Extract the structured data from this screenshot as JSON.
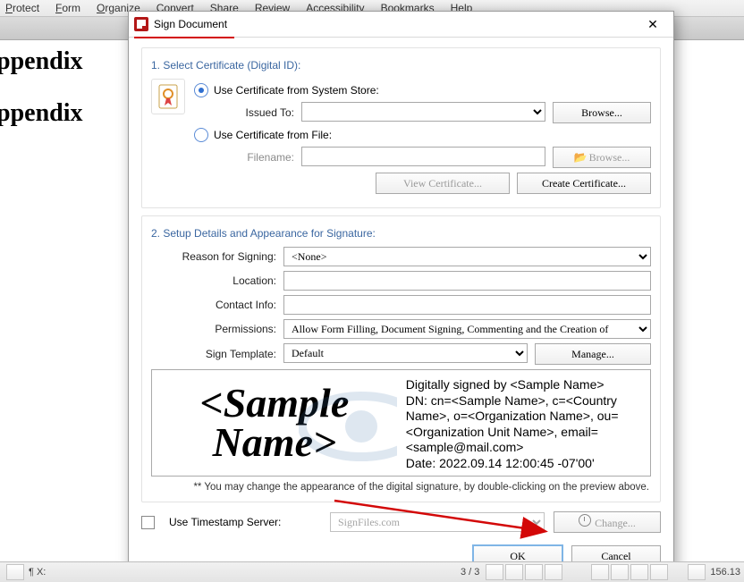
{
  "menu": {
    "items": [
      "Protect",
      "Form",
      "Organize",
      "Convert",
      "Share",
      "Review",
      "Accessibility",
      "Bookmarks",
      "Help"
    ],
    "ul": [
      "P",
      "F",
      "O",
      "C",
      "S",
      "R",
      "A",
      "B",
      "H"
    ]
  },
  "bg": {
    "line1": "ppendix",
    "line2": "ppendix"
  },
  "dialog": {
    "title": "Sign Document",
    "section1": "1. Select Certificate (Digital ID):",
    "opt_store": "Use Certificate from System Store:",
    "issued_to": "Issued To:",
    "browse": "Browse...",
    "opt_file": "Use Certificate from File:",
    "filename": "Filename:",
    "browse2": "Browse...",
    "view_cert": "View Certificate...",
    "create_cert": "Create Certificate...",
    "section2": "2. Setup Details and Appearance for Signature:",
    "reason_lbl": "Reason for Signing:",
    "reason_val": "<None>",
    "location_lbl": "Location:",
    "contact_lbl": "Contact Info:",
    "perm_lbl": "Permissions:",
    "perm_val": "Allow Form Filling, Document Signing, Commenting and the Creation of",
    "tmpl_lbl": "Sign Template:",
    "tmpl_val": "Default",
    "manage": "Manage...",
    "preview_name": "<Sample Name>",
    "preview_text": "Digitally signed by <Sample Name>\nDN: cn=<Sample Name>, c=<Country Name>, o=<Organization Name>, ou=<Organization Unit Name>, email=<sample@mail.com>\nDate: 2022.09.14 12:00:45 -07'00'",
    "note": "** You may change the appearance of the digital signature, by double-clicking on the preview above.",
    "ts_chk": "Use Timestamp Server:",
    "ts_val": "SignFiles.com",
    "change": "Change...",
    "ok": "OK",
    "cancel": "Cancel"
  },
  "status": {
    "xy": "¶ X:",
    "page": "3 / 3",
    "zoom": "156.13"
  }
}
